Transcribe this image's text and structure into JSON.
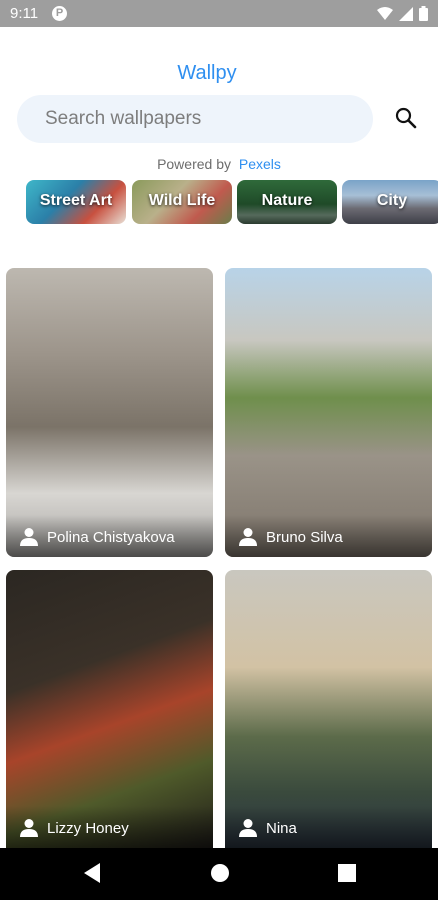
{
  "status_bar": {
    "time": "9:11"
  },
  "app": {
    "title": "Wallpy"
  },
  "search": {
    "placeholder": "Search wallpapers",
    "value": ""
  },
  "powered_by": {
    "prefix": "Powered by",
    "brand": "Pexels"
  },
  "categories": [
    {
      "label": "Street Art"
    },
    {
      "label": "Wild Life"
    },
    {
      "label": "Nature"
    },
    {
      "label": "City"
    }
  ],
  "photos": [
    {
      "author": "Polina Chistyakova"
    },
    {
      "author": "Bruno Silva"
    },
    {
      "author": "Lizzy Honey"
    },
    {
      "author": "Nina"
    }
  ],
  "colors": {
    "accent": "#2f8ff0",
    "search_bg": "#eef4fb",
    "status_bar": "#9e9e9e",
    "nav_bar": "#000000"
  }
}
